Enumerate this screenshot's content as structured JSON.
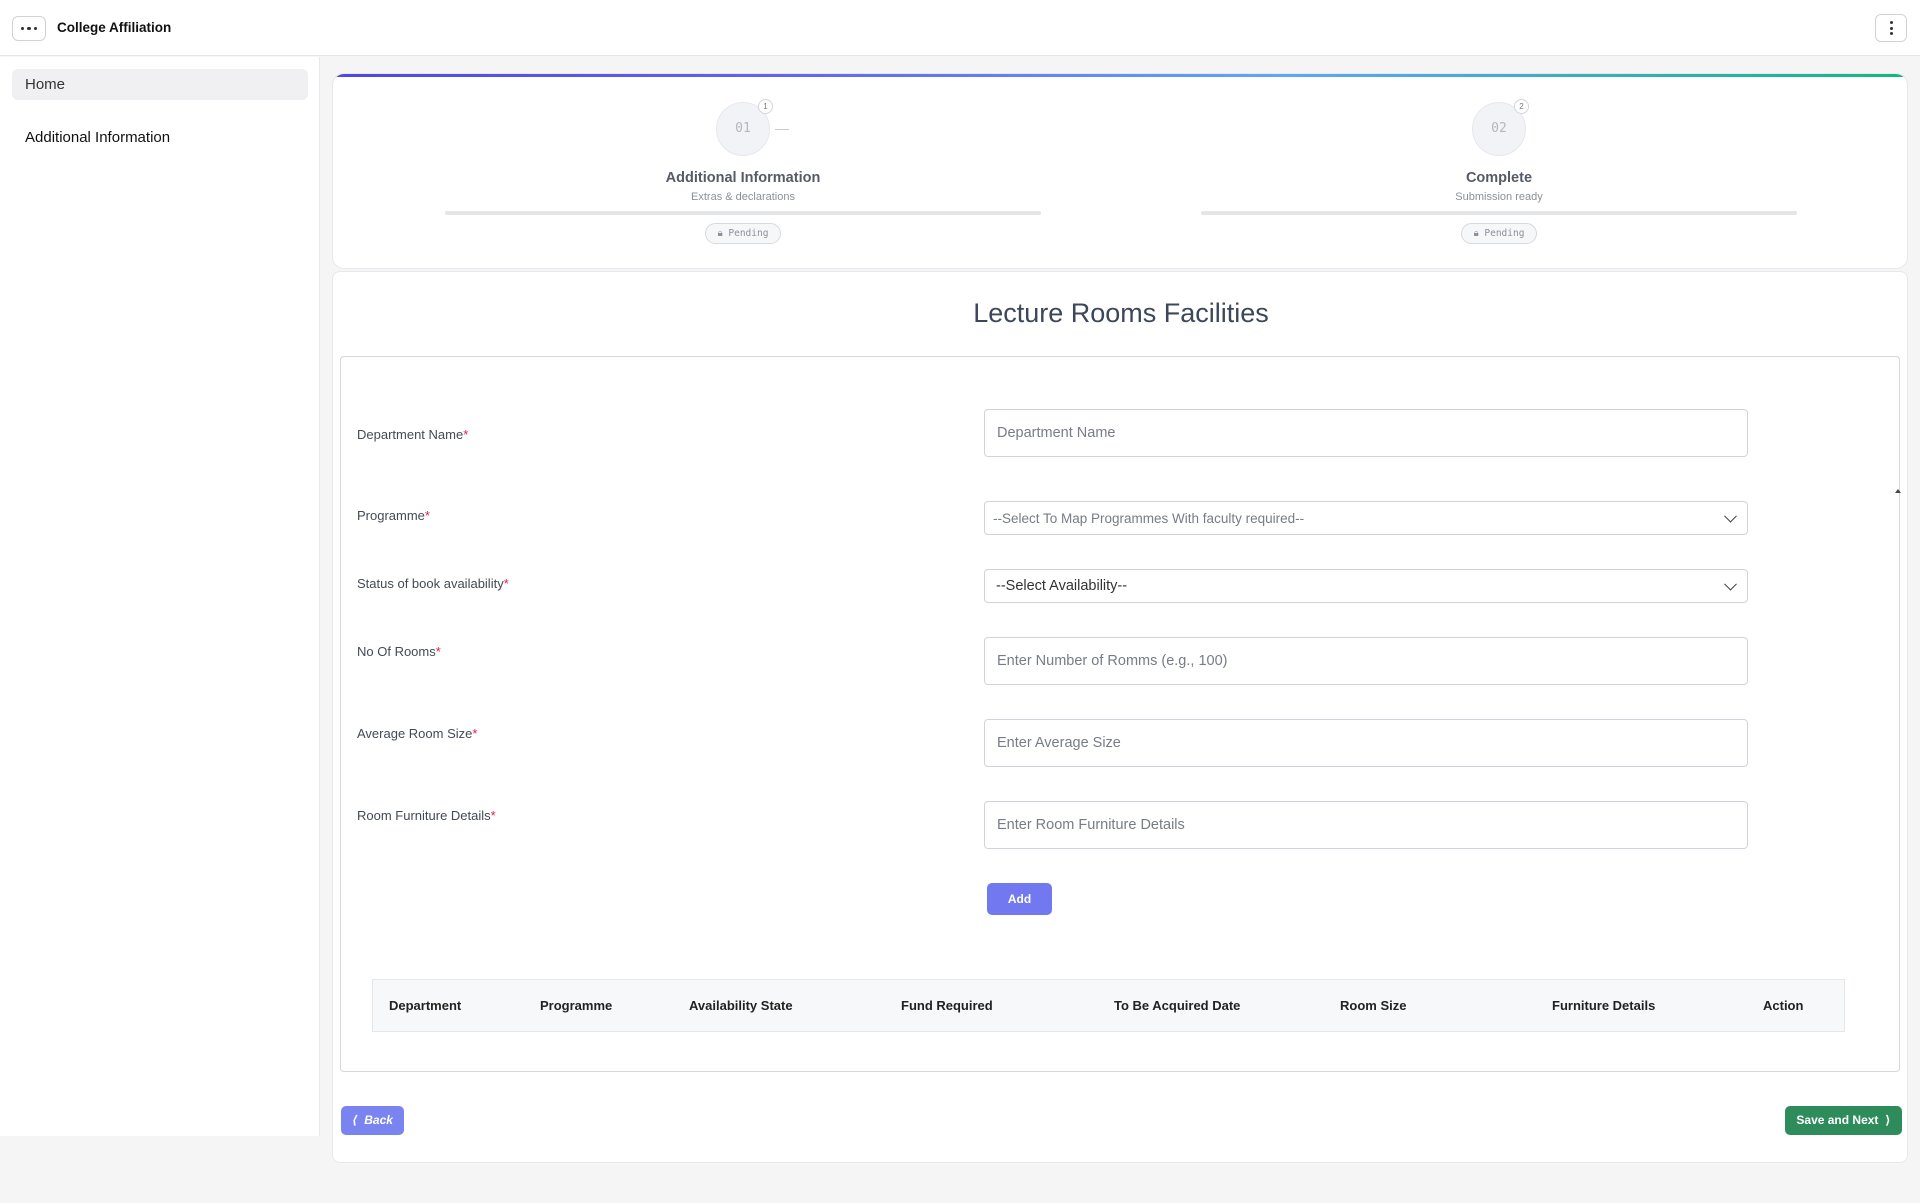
{
  "app": {
    "title": "College Affiliation"
  },
  "sidebar": {
    "items": [
      {
        "label": "Home"
      },
      {
        "label": "Additional Information"
      }
    ]
  },
  "stepper": {
    "steps": [
      {
        "number": "01",
        "badge": "1",
        "title": "Additional Information",
        "subtitle": "Extras & declarations",
        "status": "Pending"
      },
      {
        "number": "02",
        "badge": "2",
        "title": "Complete",
        "subtitle": "Submission ready",
        "status": "Pending"
      }
    ]
  },
  "form": {
    "title": "Lecture Rooms Facilities",
    "fields": [
      {
        "label": "Department Name",
        "required_mark": "*",
        "placeholder": "Department Name"
      },
      {
        "label": "Programme",
        "required_mark": "*",
        "value": "--Select To Map Programmes With faculty required--"
      },
      {
        "label": "Status of book availability",
        "required_mark": "*",
        "value": "--Select Availability--"
      },
      {
        "label": "No Of Rooms",
        "required_mark": "*",
        "placeholder": "Enter Number of Romms (e.g., 100)"
      },
      {
        "label": "Average Room Size",
        "required_mark": "*",
        "placeholder": "Enter Average Size"
      },
      {
        "label": "Room Furniture Details",
        "required_mark": "*",
        "placeholder": "Enter Room Furniture Details"
      }
    ],
    "add_label": "Add"
  },
  "table": {
    "columns": [
      "Department",
      "Programme",
      "Availability State",
      "Fund Required",
      "To Be Acquired Date",
      "Room Size",
      "Furniture Details",
      "Action"
    ]
  },
  "footer": {
    "back_label": "Back",
    "save_label": "Save and Next"
  },
  "colors": {
    "accent": "#7279f0",
    "success": "#2e8c5b",
    "required": "#e11d48"
  }
}
